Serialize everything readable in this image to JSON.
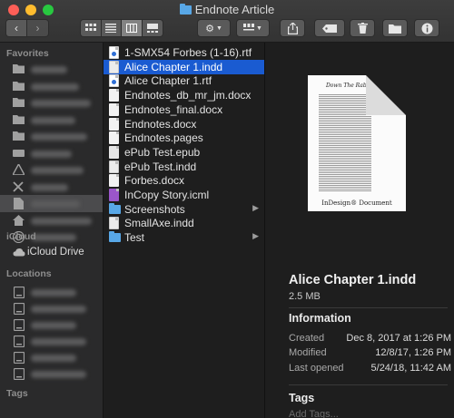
{
  "window": {
    "title": "Endnote Article"
  },
  "sidebar": {
    "favorites_header": "Favorites",
    "favorites": [
      {
        "icon": "folder-icon"
      },
      {
        "icon": "folder-icon"
      },
      {
        "icon": "folder-icon"
      },
      {
        "icon": "folder-icon"
      },
      {
        "icon": "folder-icon"
      },
      {
        "icon": "drive-icon"
      },
      {
        "icon": "apps-icon"
      },
      {
        "icon": "tools-icon"
      },
      {
        "icon": "document-icon"
      },
      {
        "icon": "home-icon"
      },
      {
        "icon": "airdrop-icon"
      }
    ],
    "icloud_header": "iCloud",
    "icloud_drive": "iCloud Drive",
    "locations_header": "Locations",
    "tags_header": "Tags"
  },
  "files": [
    {
      "name": "1-SMX54 Forbes (1-16).rtf",
      "kind": "doc-blue"
    },
    {
      "name": "Alice Chapter 1.indd",
      "kind": "doc-indd",
      "selected": true
    },
    {
      "name": "Alice Chapter 1.rtf",
      "kind": "doc-blue"
    },
    {
      "name": "Endnotes_db_mr_jm.docx",
      "kind": "doc"
    },
    {
      "name": "Endnotes_final.docx",
      "kind": "doc"
    },
    {
      "name": "Endnotes.docx",
      "kind": "doc"
    },
    {
      "name": "Endnotes.pages",
      "kind": "doc"
    },
    {
      "name": "ePub Test.epub",
      "kind": "doc-epub"
    },
    {
      "name": "ePub Test.indd",
      "kind": "doc-indd"
    },
    {
      "name": "Forbes.docx",
      "kind": "doc"
    },
    {
      "name": "InCopy Story.icml",
      "kind": "doc-icml"
    },
    {
      "name": "Screenshots",
      "kind": "folder",
      "chevron": "▶"
    },
    {
      "name": "SmallAxe.indd",
      "kind": "doc-indd"
    },
    {
      "name": "Test",
      "kind": "folder",
      "chevron": "▶"
    }
  ],
  "preview": {
    "thumb_heading": "Down The Rabbit Hole",
    "thumb_footer": "InDesign® Document",
    "title": "Alice Chapter 1.indd",
    "size": "2.5 MB",
    "information_header": "Information",
    "info": [
      {
        "key": "Created",
        "value": "Dec 8, 2017 at 1:26 PM"
      },
      {
        "key": "Modified",
        "value": "12/8/17, 1:26 PM"
      },
      {
        "key": "Last opened",
        "value": "5/24/18, 11:42 AM"
      }
    ],
    "tags_header": "Tags",
    "tags_placeholder": "Add Tags..."
  }
}
